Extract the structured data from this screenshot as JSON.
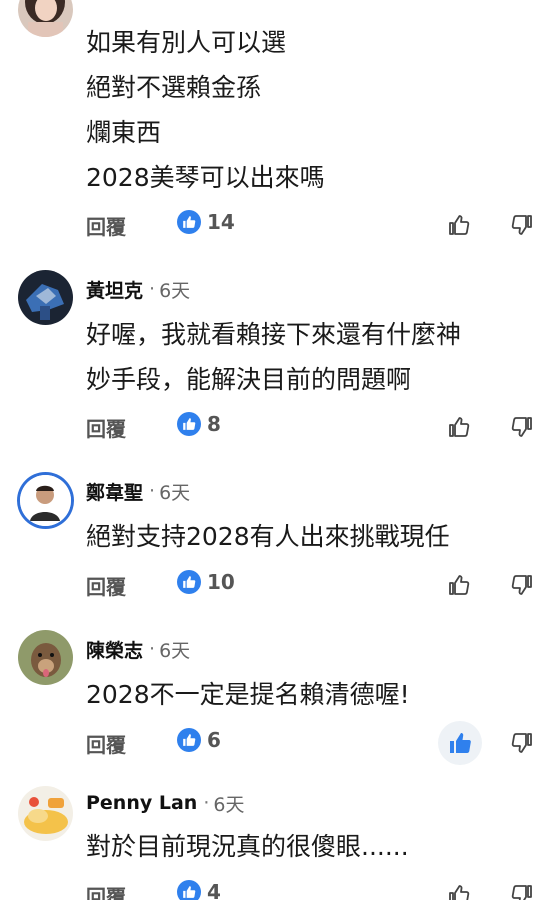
{
  "common": {
    "reply_label": "回覆",
    "separator": "·"
  },
  "comments": [
    {
      "author": "",
      "time": "",
      "lines": [
        "如果有別人可以選",
        "絕對不選賴金孫",
        "爛東西",
        "2028美琴可以出來嗎"
      ],
      "likes": "14",
      "liked": false
    },
    {
      "author": "黃坦克",
      "time": "6天",
      "lines": [
        "好喔，我就看賴接下來還有什麼神",
        "妙手段，能解決目前的問題啊"
      ],
      "likes": "8",
      "liked": false
    },
    {
      "author": "鄭韋聖",
      "time": "6天",
      "lines": [
        "絕對支持2028有人出來挑戰現任"
      ],
      "likes": "10",
      "liked": false
    },
    {
      "author": "陳榮志",
      "time": "6天",
      "lines": [
        "2028不一定是提名賴清德喔!"
      ],
      "likes": "6",
      "liked": true
    },
    {
      "author": "Penny Lan",
      "time": "6天",
      "lines": [
        "對於目前現況真的很傻眼......"
      ],
      "likes": "4",
      "liked": false
    }
  ],
  "colors": {
    "like_blue": "#2f80ed",
    "avatar_ring": "#2f6fd8",
    "active_bg": "#eef2f6"
  },
  "icons": {
    "like_badge": "thumbs-up-badge-icon",
    "thumb_up": "thumbs-up-outline-icon",
    "thumb_up_active": "thumbs-up-filled-icon",
    "thumb_down": "thumbs-down-outline-icon"
  }
}
